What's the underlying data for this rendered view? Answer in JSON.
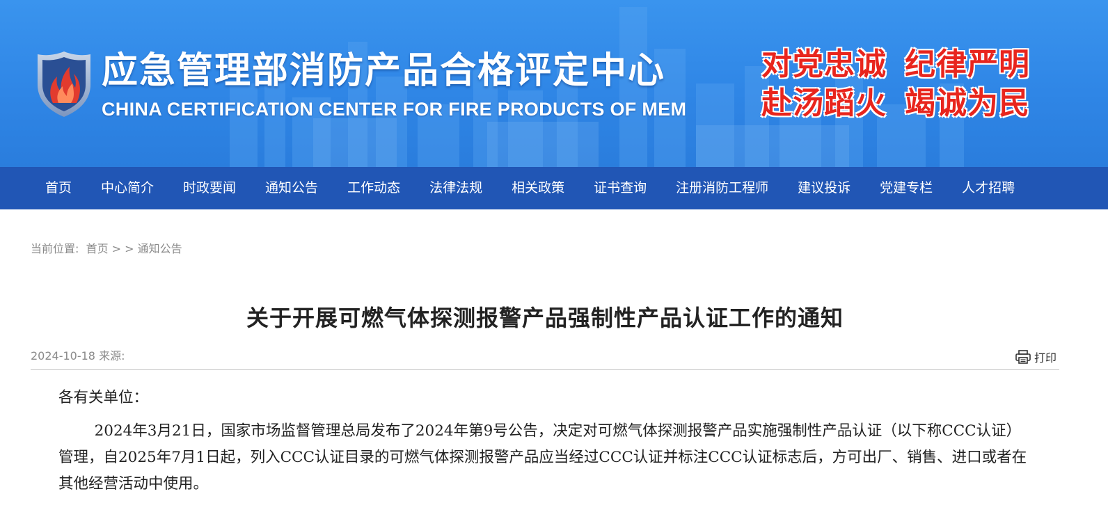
{
  "header": {
    "title_cn": "应急管理部消防产品合格评定中心",
    "title_en": "CHINA CERTIFICATION CENTER FOR FIRE PRODUCTS OF MEM",
    "slogan": {
      "line1_a": "对党忠诚",
      "line1_b": "纪律严明",
      "line2_a": "赴汤蹈火",
      "line2_b": "竭诚为民"
    },
    "colors": {
      "banner": "#2f86e6",
      "nav": "#2156b5",
      "slogan": "#e8251d"
    }
  },
  "nav": {
    "items": [
      "首页",
      "中心简介",
      "时政要闻",
      "通知公告",
      "工作动态",
      "法律法规",
      "相关政策",
      "证书查询",
      "注册消防工程师",
      "建议投诉",
      "党建专栏",
      "人才招聘"
    ]
  },
  "breadcrumb": {
    "prefix": "当前位置:",
    "home": "首页",
    "sep": " > > ",
    "current": "通知公告"
  },
  "article": {
    "title": "关于开展可燃气体探测报警产品强制性产品认证工作的通知",
    "date": "2024-10-18",
    "source_label": "来源:",
    "print_label": "打印",
    "salutation": "各有关单位：",
    "paragraph1": "2024年3月21日，国家市场监督管理总局发布了2024年第9号公告，决定对可燃气体探测报警产品实施强制性产品认证（以下称CCC认证）管理，自2025年7月1日起，列入CCC认证目录的可燃气体探测报警产品应当经过CCC认证并标注CCC认证标志后，方可出厂、销售、进口或者在其他经营活动中使用。"
  },
  "icons": {
    "logo": "flame-shield-emblem",
    "print": "printer-icon"
  }
}
